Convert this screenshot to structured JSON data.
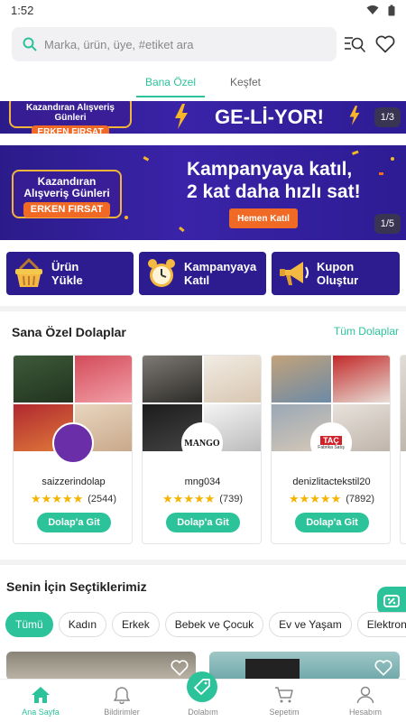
{
  "status_bar": {
    "time": "1:52",
    "icons": [
      "wifi-icon",
      "battery-icon"
    ]
  },
  "search": {
    "placeholder": "Marka, ürün, üye, #etiket ara"
  },
  "tabs": [
    {
      "label": "Bana Özel",
      "active": true
    },
    {
      "label": "Keşfet",
      "active": false
    }
  ],
  "banner_top": {
    "badge_title": "Kazandıran Alışveriş Günleri",
    "badge_sub": "ERKEN FIRSAT",
    "headline": "GE-Lİ-YOR!",
    "pager": "1/3"
  },
  "banner_main": {
    "badge_title_line1": "Kazandıran",
    "badge_title_line2": "Alışveriş Günleri",
    "badge_sub": "ERKEN FIRSAT",
    "headline_line1": "Kampanyaya katıl,",
    "headline_line2": "2 kat daha hızlı sat!",
    "cta": "Hemen Katıl",
    "pager": "1/5"
  },
  "quick_actions": [
    {
      "line1": "Ürün",
      "line2": "Yükle",
      "icon": "basket-icon"
    },
    {
      "line1": "Kampanyaya",
      "line2": "Katıl",
      "icon": "alarm-clock-icon"
    },
    {
      "line1": "Kupon",
      "line2": "Oluştur",
      "icon": "megaphone-icon"
    }
  ],
  "closets": {
    "title": "Sana Özel Dolaplar",
    "link": "Tüm Dolaplar",
    "items": [
      {
        "username": "saizzerindolap",
        "rating_count": "(2544)",
        "button": "Dolap'a Git",
        "rating": 5,
        "avatar": "purple-circle"
      },
      {
        "username": "mng034",
        "rating_count": "(739)",
        "button": "Dolap'a Git",
        "rating": 5,
        "avatar": "MANGO"
      },
      {
        "username": "denizlitactekstil20",
        "rating_count": "(7892)",
        "button": "Dolap'a Git",
        "rating": 5,
        "avatar_line1": "TAÇ",
        "avatar_line2": "Fabrika Satış"
      }
    ]
  },
  "picks": {
    "title": "Senin İçin Seçtiklerimiz",
    "chips": [
      {
        "label": "Tümü",
        "active": true
      },
      {
        "label": "Kadın"
      },
      {
        "label": "Erkek"
      },
      {
        "label": "Bebek ve Çocuk"
      },
      {
        "label": "Ev ve Yaşam"
      },
      {
        "label": "Elektronik"
      }
    ]
  },
  "bottom_nav": [
    {
      "label": "Ana Sayfa",
      "icon": "home-icon",
      "active": true
    },
    {
      "label": "Bildirimler",
      "icon": "bell-icon"
    },
    {
      "label": "Dolabım",
      "icon": "tag-icon"
    },
    {
      "label": "Sepetim",
      "icon": "cart-icon"
    },
    {
      "label": "Hesabım",
      "icon": "user-icon"
    }
  ],
  "colors": {
    "accent": "#2cc39a",
    "banner": "#2c1c8f",
    "promo_orange": "#f06a25",
    "star": "#f6b400"
  }
}
